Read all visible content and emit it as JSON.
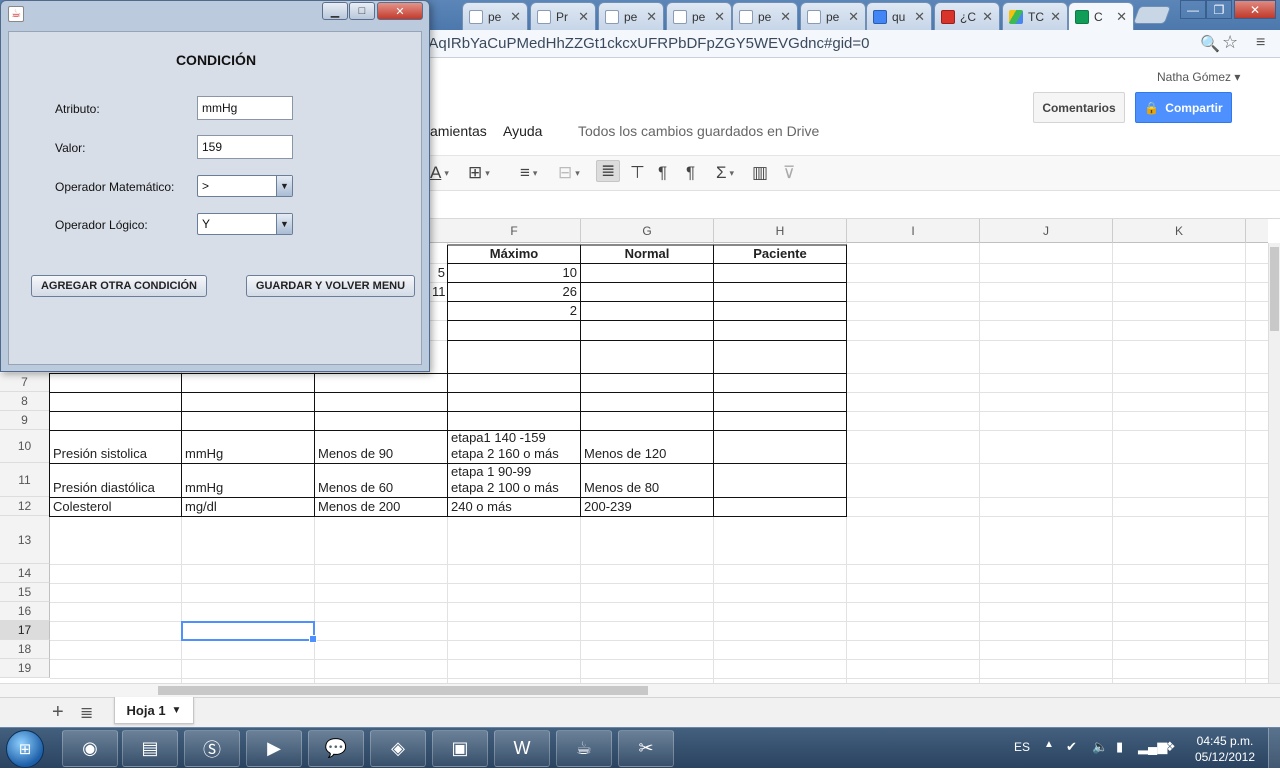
{
  "browser": {
    "tabs": [
      {
        "title": "pe",
        "icon": "doc-icon"
      },
      {
        "title": "Pr",
        "icon": "doc-icon"
      },
      {
        "title": "pe",
        "icon": "doc-icon"
      },
      {
        "title": "pe",
        "icon": "doc-icon"
      },
      {
        "title": "pe",
        "icon": "doc-icon"
      },
      {
        "title": "pe",
        "icon": "doc-icon"
      },
      {
        "title": "qu",
        "icon": "google-icon"
      },
      {
        "title": "¿C",
        "icon": "pdf-icon"
      },
      {
        "title": "TC",
        "icon": "drive-icon"
      },
      {
        "title": "C",
        "icon": "sheets-icon"
      }
    ],
    "url": "0AqIRbYaCuPMedHhZZGt1ckcxUFRPbDFpZGY5WEVGdnc#gid=0",
    "minimize": "—",
    "maximize": "❐",
    "close": "✕"
  },
  "sheets": {
    "user": "Natha Gómez ▾",
    "comments_label": "Comentarios",
    "share_label": "Compartir",
    "menu_tools": "amientas",
    "menu_help": "Ayuda",
    "save_status": "Todos los cambios guardados en Drive",
    "sheet_tab": "Hoja 1"
  },
  "grid": {
    "columns": [
      "F",
      "G",
      "H",
      "I",
      "J",
      "K"
    ],
    "rows": [
      "7",
      "8",
      "9",
      "10",
      "11",
      "12",
      "13",
      "14",
      "15",
      "16",
      "17",
      "18",
      "19"
    ],
    "header_cells": {
      "F": "Máximo",
      "G": "Normal",
      "H": "Paciente"
    },
    "partial_e": [
      "5",
      "11"
    ],
    "maximo_values": [
      "10",
      "26",
      "2"
    ],
    "data_rows": [
      {
        "a": "Presión sistolica",
        "b": "mmHg",
        "c": "Menos de 90",
        "f1": "etapa1 140 -159",
        "f2": "etapa 2 160 o más",
        "g": "Menos de 120"
      },
      {
        "a": "Presión diastólica",
        "b": "mmHg",
        "c": "Menos de 60",
        "f1": "etapa 1 90-99",
        "f2": "etapa 2 100 o más",
        "g": "Menos de 80"
      },
      {
        "a": "Colesterol",
        "b": "mg/dl",
        "c": "Menos de 200",
        "f1": "240 o más",
        "f2": "",
        "g": "200-239"
      }
    ]
  },
  "dialog": {
    "heading": "CONDICIÓN",
    "attr_label": "Atributo:",
    "attr_value": "mmHg",
    "value_label": "Valor:",
    "value_value": "159",
    "math_op_label": "Operador Matemático:",
    "math_op_value": ">",
    "logic_op_label": "Operador Lógico:",
    "logic_op_value": "Y",
    "add_button": "AGREGAR OTRA CONDICIÓN",
    "save_button": "GUARDAR Y VOLVER MENU"
  },
  "taskbar": {
    "lang": "ES",
    "time": "04:45 p.m.",
    "date": "05/12/2012"
  },
  "colors": {
    "accent_blue": "#4d90fe",
    "dialog_bg": "#d8dee8"
  }
}
